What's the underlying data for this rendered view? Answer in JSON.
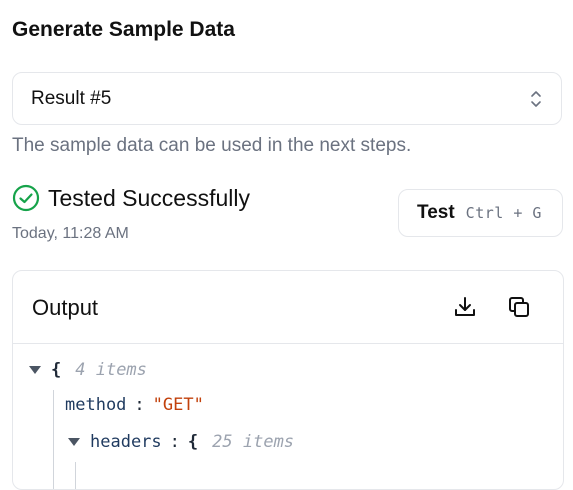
{
  "section": {
    "title": "Generate Sample Data"
  },
  "select": {
    "value": "Result #5"
  },
  "helper_text": "The sample data can be used in the next steps.",
  "status": {
    "text": "Tested Successfully",
    "timestamp": "Today, 11:28 AM",
    "color": "#16a34a"
  },
  "test_button": {
    "label": "Test",
    "shortcut": "Ctrl + G"
  },
  "output": {
    "title": "Output",
    "json": {
      "root_brace": "{",
      "root_count": "4 items",
      "method_key": "method",
      "method_value": "\"GET\"",
      "headers_key": "headers",
      "headers_brace": "{",
      "headers_count": "25 items"
    }
  }
}
